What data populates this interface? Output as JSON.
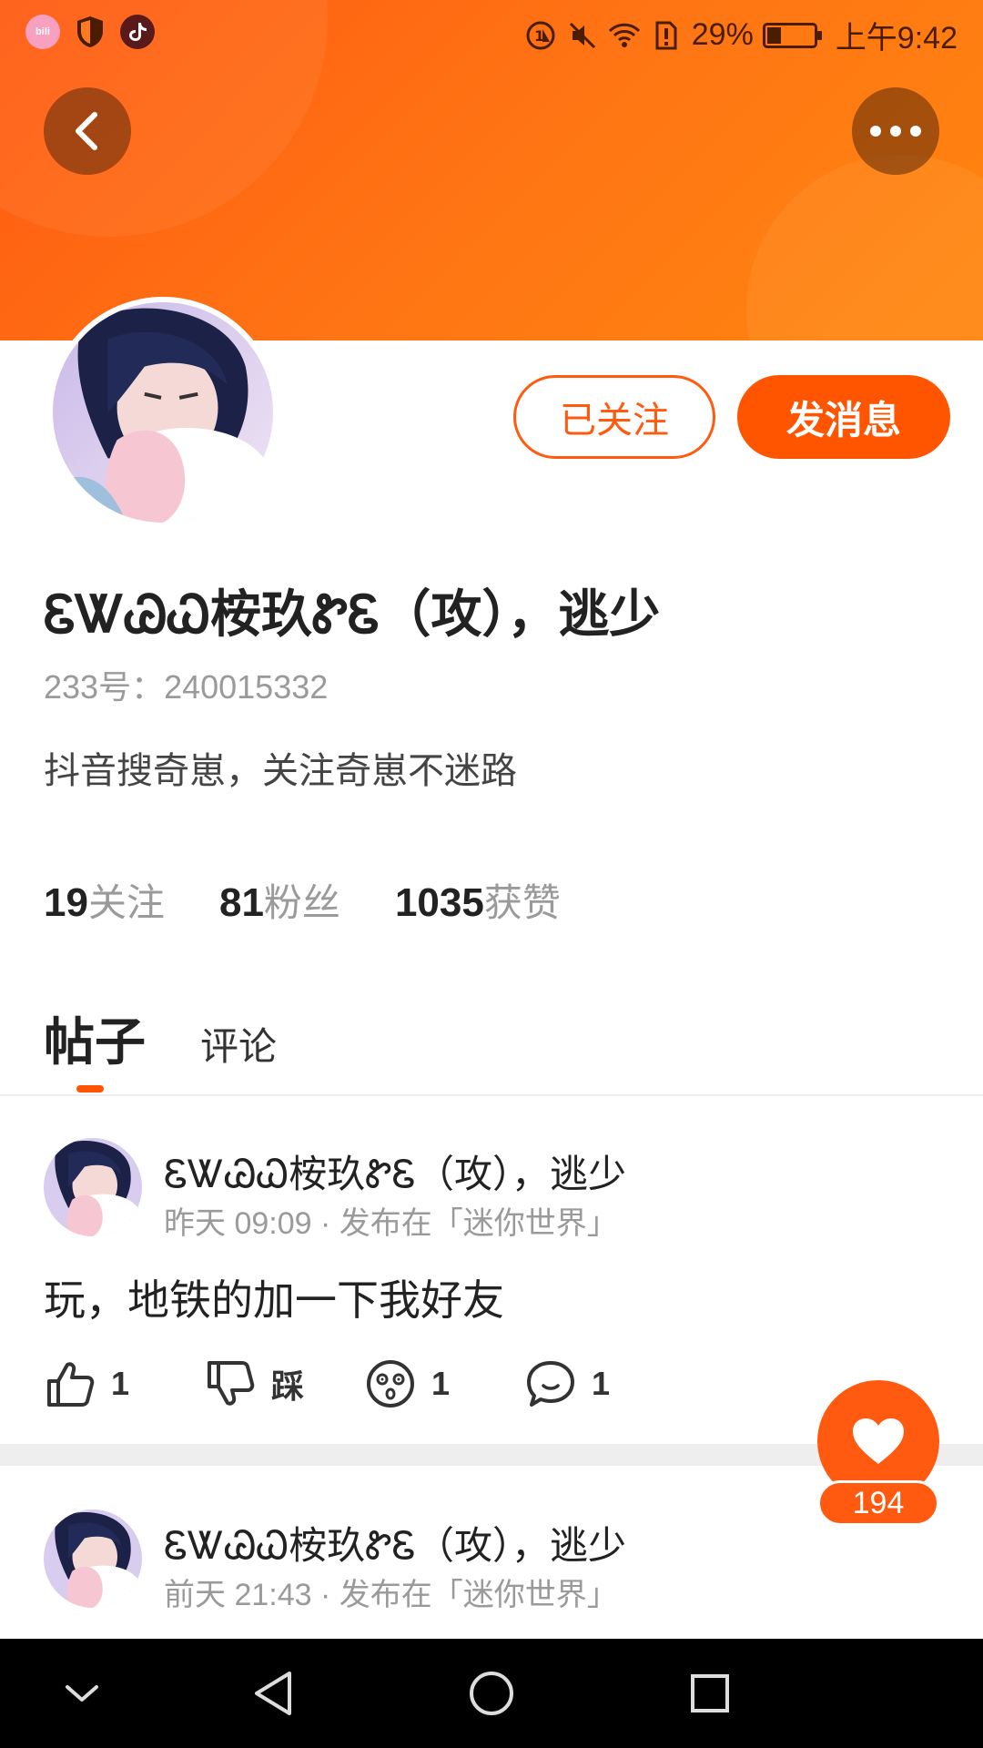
{
  "status_bar": {
    "battery_text": "29%",
    "time": "上午9:42",
    "left_apps": [
      "bilibili-icon",
      "shield-icon",
      "tiktok-icon"
    ]
  },
  "profile": {
    "display_name": "ᏋᏔᏊᏇ桉玖ᏑᏋ（攻），逃少",
    "uid": "233号：240015332",
    "bio": "抖音搜奇崽，关注奇崽不迷路",
    "follow_label": "已关注",
    "message_label": "发消息",
    "stats": [
      {
        "num": "19",
        "label": "关注"
      },
      {
        "num": "81",
        "label": "粉丝"
      },
      {
        "num": "1035",
        "label": "获赞"
      }
    ]
  },
  "tabs": {
    "active": "帖子",
    "other": "评论"
  },
  "posts": [
    {
      "author": "ᏋᏔᏊᏇ桉玖ᏑᏋ（攻），逃少",
      "meta": "昨天 09:09 · 发布在「迷你世界」",
      "text": "玩，地铁的加一下我好友",
      "likes": "1",
      "dislike_label": "踩",
      "reactions": "1",
      "comments": "1"
    },
    {
      "author": "ᏋᏔᏊᏇ桉玖ᏑᏋ（攻），逃少",
      "meta": "前天 21:43 · 发布在「迷你世界」"
    }
  ],
  "fab": {
    "count": "194"
  },
  "colors": {
    "accent": "#ff5a10",
    "header_start": "#ff5a10",
    "header_end": "#ff860f"
  }
}
